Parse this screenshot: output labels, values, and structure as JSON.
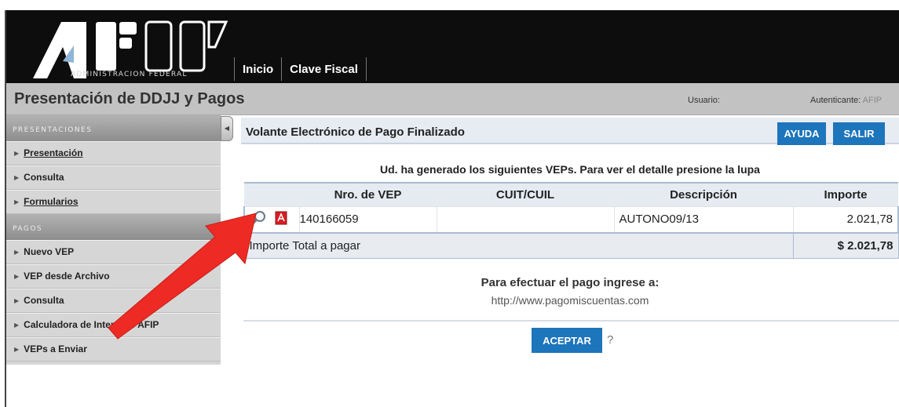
{
  "header": {
    "logo_caption": "ADMINISTRACION FEDERAL",
    "nav": [
      "Inicio",
      "Clave Fiscal"
    ]
  },
  "titlebar": {
    "title": "Presentación de DDJJ y Pagos",
    "usuario_label": "Usuario:",
    "autenticante_label": "Autenticante:",
    "autenticante_value": "AFIP"
  },
  "sidebar": {
    "section1": "PRESENTACIONES",
    "items1": [
      "Presentación",
      "Consulta",
      "Formularios"
    ],
    "section2": "PAGOS",
    "items2": [
      "Nuevo VEP",
      "VEP desde Archivo",
      "Consulta",
      "Calculadora de Intereses AFIP",
      "VEPs a Enviar"
    ]
  },
  "content": {
    "title": "Volante Electrónico de Pago Finalizado",
    "ayuda_label": "AYUDA",
    "salir_label": "SALIR",
    "message": "Ud. ha generado los siguientes VEPs. Para ver el detalle presione la lupa",
    "table": {
      "headers": [
        "Nro. de VEP",
        "CUIT/CUIL",
        "Descripción",
        "Importe"
      ],
      "row": {
        "nro": "140166059",
        "cuit": "",
        "descripcion": "AUTONO09/13",
        "importe": "2.021,78"
      },
      "total_label": "Importe Total a pagar",
      "total_value": "$ 2.021,78"
    },
    "pay_line1": "Para efectuar el pago ingrese a:",
    "pay_line2": "http://www.pagomiscuentas.com",
    "aceptar_label": "ACEPTAR",
    "help_mark": "?"
  },
  "colors": {
    "header_bg": "#0d0d0d",
    "button_blue": "#1d75bb",
    "arrow_red": "#ee2a24"
  },
  "icons": {
    "magnifier": "magnifier-icon",
    "pdf": "pdf-icon",
    "collapse": "collapse-arrow-icon"
  }
}
